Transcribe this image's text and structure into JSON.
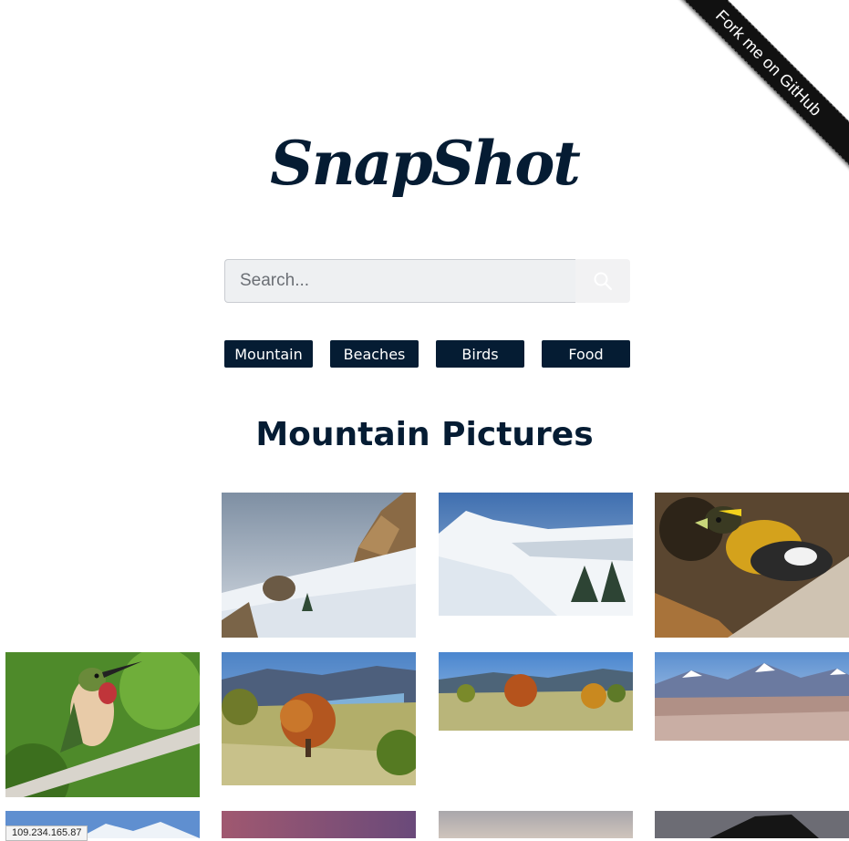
{
  "ribbon": {
    "label": "Fork me on GitHub"
  },
  "header": {
    "title": "SnapShot"
  },
  "search": {
    "placeholder": "Search...",
    "value": ""
  },
  "categories": [
    "Mountain",
    "Beaches",
    "Birds",
    "Food"
  ],
  "gallery": {
    "heading": "Mountain Pictures",
    "photos": [
      "snowy-rocky-slope",
      "snow-ridge-blue-sky",
      "evening-grosbeak-bird",
      "hummingbird-on-branch",
      "autumn-tree-lake-valley",
      "autumn-tree-meadow",
      "desert-rocks-snowy-peaks",
      "snowy-peak-partial",
      "pink-sky-partial",
      "hazy-sky-partial",
      "dark-peak-silhouette-partial"
    ]
  },
  "status": {
    "ip": "109.234.165.87"
  },
  "colors": {
    "brand": "#051c33",
    "search_bg": "#eef0f2"
  }
}
